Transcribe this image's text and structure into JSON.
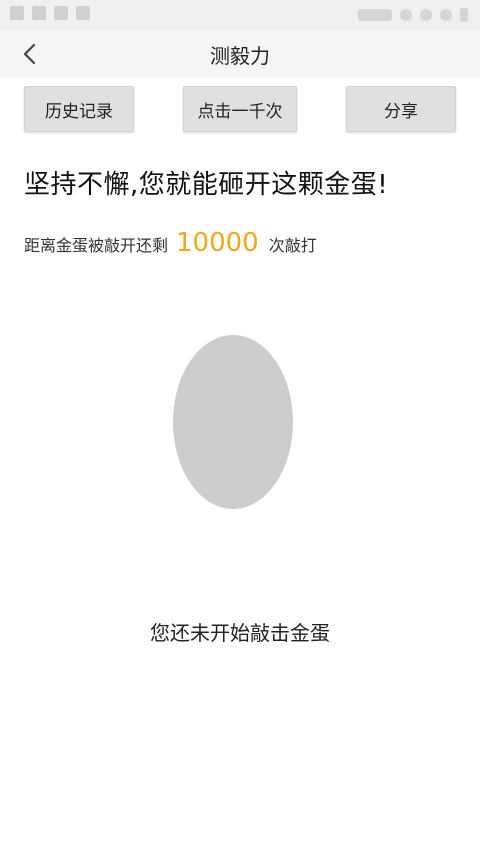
{
  "nav": {
    "title": "测毅力",
    "back_icon": "chevron-left-icon"
  },
  "actions": {
    "history_label": "历史记录",
    "click1000_label": "点击一千次",
    "share_label": "分享"
  },
  "main": {
    "headline": "坚持不懈,您就能砸开这颗金蛋!",
    "counter_prefix": "距离金蛋被敲开还剩",
    "counter_value": "10000",
    "counter_suffix": "次敲打",
    "status_text": "您还未开始敲击金蛋"
  },
  "colors": {
    "accent": "#f2a81d",
    "egg": "#cccccc",
    "button_bg": "#e0e0e0"
  }
}
